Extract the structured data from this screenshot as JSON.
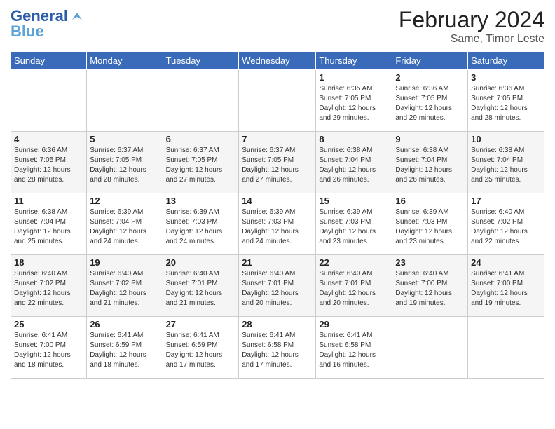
{
  "logo": {
    "line1": "General",
    "line2": "Blue"
  },
  "title": "February 2024",
  "subtitle": "Same, Timor Leste",
  "days_of_week": [
    "Sunday",
    "Monday",
    "Tuesday",
    "Wednesday",
    "Thursday",
    "Friday",
    "Saturday"
  ],
  "weeks": [
    [
      {
        "day": "",
        "info": ""
      },
      {
        "day": "",
        "info": ""
      },
      {
        "day": "",
        "info": ""
      },
      {
        "day": "",
        "info": ""
      },
      {
        "day": "1",
        "info": "Sunrise: 6:35 AM\nSunset: 7:05 PM\nDaylight: 12 hours\nand 29 minutes."
      },
      {
        "day": "2",
        "info": "Sunrise: 6:36 AM\nSunset: 7:05 PM\nDaylight: 12 hours\nand 29 minutes."
      },
      {
        "day": "3",
        "info": "Sunrise: 6:36 AM\nSunset: 7:05 PM\nDaylight: 12 hours\nand 28 minutes."
      }
    ],
    [
      {
        "day": "4",
        "info": "Sunrise: 6:36 AM\nSunset: 7:05 PM\nDaylight: 12 hours\nand 28 minutes."
      },
      {
        "day": "5",
        "info": "Sunrise: 6:37 AM\nSunset: 7:05 PM\nDaylight: 12 hours\nand 28 minutes."
      },
      {
        "day": "6",
        "info": "Sunrise: 6:37 AM\nSunset: 7:05 PM\nDaylight: 12 hours\nand 27 minutes."
      },
      {
        "day": "7",
        "info": "Sunrise: 6:37 AM\nSunset: 7:05 PM\nDaylight: 12 hours\nand 27 minutes."
      },
      {
        "day": "8",
        "info": "Sunrise: 6:38 AM\nSunset: 7:04 PM\nDaylight: 12 hours\nand 26 minutes."
      },
      {
        "day": "9",
        "info": "Sunrise: 6:38 AM\nSunset: 7:04 PM\nDaylight: 12 hours\nand 26 minutes."
      },
      {
        "day": "10",
        "info": "Sunrise: 6:38 AM\nSunset: 7:04 PM\nDaylight: 12 hours\nand 25 minutes."
      }
    ],
    [
      {
        "day": "11",
        "info": "Sunrise: 6:38 AM\nSunset: 7:04 PM\nDaylight: 12 hours\nand 25 minutes."
      },
      {
        "day": "12",
        "info": "Sunrise: 6:39 AM\nSunset: 7:04 PM\nDaylight: 12 hours\nand 24 minutes."
      },
      {
        "day": "13",
        "info": "Sunrise: 6:39 AM\nSunset: 7:03 PM\nDaylight: 12 hours\nand 24 minutes."
      },
      {
        "day": "14",
        "info": "Sunrise: 6:39 AM\nSunset: 7:03 PM\nDaylight: 12 hours\nand 24 minutes."
      },
      {
        "day": "15",
        "info": "Sunrise: 6:39 AM\nSunset: 7:03 PM\nDaylight: 12 hours\nand 23 minutes."
      },
      {
        "day": "16",
        "info": "Sunrise: 6:39 AM\nSunset: 7:03 PM\nDaylight: 12 hours\nand 23 minutes."
      },
      {
        "day": "17",
        "info": "Sunrise: 6:40 AM\nSunset: 7:02 PM\nDaylight: 12 hours\nand 22 minutes."
      }
    ],
    [
      {
        "day": "18",
        "info": "Sunrise: 6:40 AM\nSunset: 7:02 PM\nDaylight: 12 hours\nand 22 minutes."
      },
      {
        "day": "19",
        "info": "Sunrise: 6:40 AM\nSunset: 7:02 PM\nDaylight: 12 hours\nand 21 minutes."
      },
      {
        "day": "20",
        "info": "Sunrise: 6:40 AM\nSunset: 7:01 PM\nDaylight: 12 hours\nand 21 minutes."
      },
      {
        "day": "21",
        "info": "Sunrise: 6:40 AM\nSunset: 7:01 PM\nDaylight: 12 hours\nand 20 minutes."
      },
      {
        "day": "22",
        "info": "Sunrise: 6:40 AM\nSunset: 7:01 PM\nDaylight: 12 hours\nand 20 minutes."
      },
      {
        "day": "23",
        "info": "Sunrise: 6:40 AM\nSunset: 7:00 PM\nDaylight: 12 hours\nand 19 minutes."
      },
      {
        "day": "24",
        "info": "Sunrise: 6:41 AM\nSunset: 7:00 PM\nDaylight: 12 hours\nand 19 minutes."
      }
    ],
    [
      {
        "day": "25",
        "info": "Sunrise: 6:41 AM\nSunset: 7:00 PM\nDaylight: 12 hours\nand 18 minutes."
      },
      {
        "day": "26",
        "info": "Sunrise: 6:41 AM\nSunset: 6:59 PM\nDaylight: 12 hours\nand 18 minutes."
      },
      {
        "day": "27",
        "info": "Sunrise: 6:41 AM\nSunset: 6:59 PM\nDaylight: 12 hours\nand 17 minutes."
      },
      {
        "day": "28",
        "info": "Sunrise: 6:41 AM\nSunset: 6:58 PM\nDaylight: 12 hours\nand 17 minutes."
      },
      {
        "day": "29",
        "info": "Sunrise: 6:41 AM\nSunset: 6:58 PM\nDaylight: 12 hours\nand 16 minutes."
      },
      {
        "day": "",
        "info": ""
      },
      {
        "day": "",
        "info": ""
      }
    ]
  ]
}
